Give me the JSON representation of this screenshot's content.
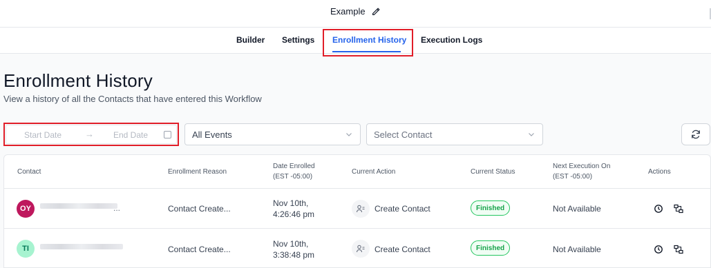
{
  "header": {
    "workflow_name": "Example"
  },
  "tabs": [
    {
      "label": "Builder"
    },
    {
      "label": "Settings"
    },
    {
      "label": "Enrollment History"
    },
    {
      "label": "Execution Logs"
    }
  ],
  "page": {
    "title": "Enrollment History",
    "subtitle": "View a history of all the Contacts that have entered this Workflow"
  },
  "filters": {
    "start_date_placeholder": "Start Date",
    "range_arrow": "→",
    "end_date_placeholder": "End Date",
    "events_value": "All Events",
    "contact_placeholder": "Select Contact"
  },
  "table": {
    "columns": {
      "contact": "Contact",
      "enrollment_reason": "Enrollment Reason",
      "date_enrolled": "Date Enrolled",
      "date_enrolled_tz": "(EST -05:00)",
      "current_action": "Current Action",
      "current_status": "Current Status",
      "next_execution": "Next Execution On",
      "next_execution_tz": "(EST -05:00)",
      "actions": "Actions"
    },
    "rows": [
      {
        "initials": "OY",
        "avatar_bg": "#be185d",
        "avatar_fg": "#ffffff",
        "name_suffix": "...",
        "reason": "Contact Create...",
        "date_line1": "Nov 10th,",
        "date_line2": "4:26:46 pm",
        "action": "Create Contact",
        "status": "Finished",
        "next": "Not Available"
      },
      {
        "initials": "TI",
        "avatar_bg": "#a7f3d0",
        "avatar_fg": "#047857",
        "name_suffix": "",
        "reason": "Contact Create...",
        "date_line1": "Nov 10th,",
        "date_line2": "3:38:48 pm",
        "action": "Create Contact",
        "status": "Finished",
        "next": "Not Available"
      }
    ]
  },
  "colors": {
    "accent": "#2563eb",
    "highlight": "#e11d28",
    "status_green": "#16a34a"
  }
}
